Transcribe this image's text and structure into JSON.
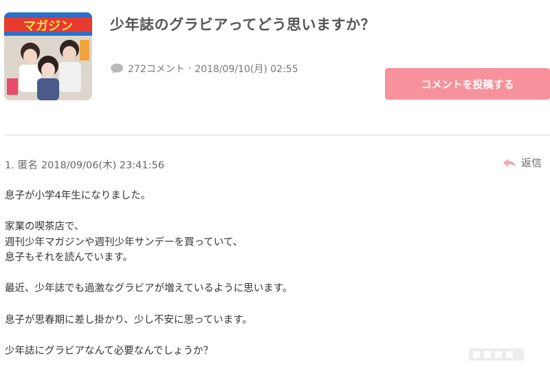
{
  "topic": {
    "title": "少年誌のグラビアってどう思いますか？",
    "comment_count": "272コメント",
    "posted_at": "2018/09/10(月) 02:55",
    "post_button_label": "コメントを投稿する",
    "thumbnail_icon": "magazine-cover-image"
  },
  "comment": {
    "number": "1.",
    "author": "匿名",
    "datetime": "2018/09/06(木) 23:41:56",
    "reply_label": "返信",
    "paragraphs": [
      [
        "息子が小学4年生になりました。"
      ],
      [
        "家業の喫茶店で、",
        "週刊少年マガジンや週刊少年サンデーを買っていて、",
        "息子もそれを読んでいます。"
      ],
      [
        "最近、少年誌でも過激なグラビアが増えているように思います。"
      ],
      [
        "息子が思春期に差し掛かり、少し不安に思っています。"
      ],
      [
        "少年誌にグラビアなんて必要なんでしょうか？"
      ]
    ]
  },
  "colors": {
    "accent": "#f7929c",
    "reply_icon": "#f7929c",
    "divider": "#dddddd"
  }
}
